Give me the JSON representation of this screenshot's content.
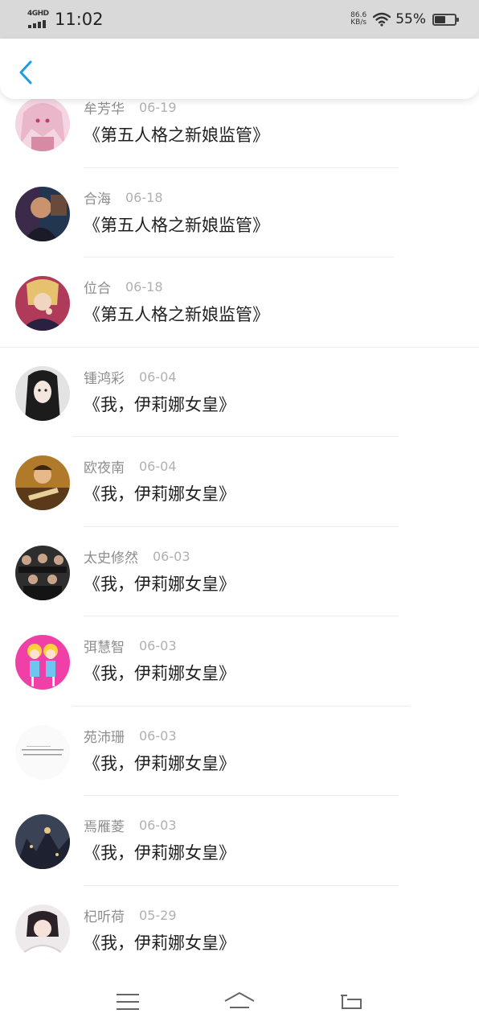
{
  "status_bar": {
    "network": "4GHD",
    "time": "11:02",
    "speed_value": "86.6",
    "speed_unit": "KB/s",
    "battery_percent": "55%",
    "battery_level": 0.55
  },
  "nav": {
    "back_icon": "chevron-left-icon",
    "accent_color": "#1e9be6"
  },
  "items": [
    {
      "name": "牟芳华",
      "date": "06-19",
      "title": "《第五人格之新娘监管》"
    },
    {
      "name": "合海",
      "date": "06-18",
      "title": "《第五人格之新娘监管》"
    },
    {
      "name": "位合",
      "date": "06-18",
      "title": "《第五人格之新娘监管》"
    },
    {
      "name": "锺鸿彩",
      "date": "06-04",
      "title": "《我，伊莉娜女皇》"
    },
    {
      "name": "欧夜南",
      "date": "06-04",
      "title": "《我，伊莉娜女皇》"
    },
    {
      "name": "太史修然",
      "date": "06-03",
      "title": "《我，伊莉娜女皇》"
    },
    {
      "name": "弭慧智",
      "date": "06-03",
      "title": "《我，伊莉娜女皇》"
    },
    {
      "name": "苑沛珊",
      "date": "06-03",
      "title": "《我，伊莉娜女皇》"
    },
    {
      "name": "焉雁菱",
      "date": "06-03",
      "title": "《我，伊莉娜女皇》"
    },
    {
      "name": "杞听荷",
      "date": "05-29",
      "title": "《我，伊莉娜女皇》"
    }
  ],
  "bottom_nav": {
    "menu_icon": "menu-icon",
    "home_icon": "home-icon",
    "back_icon": "return-icon"
  }
}
